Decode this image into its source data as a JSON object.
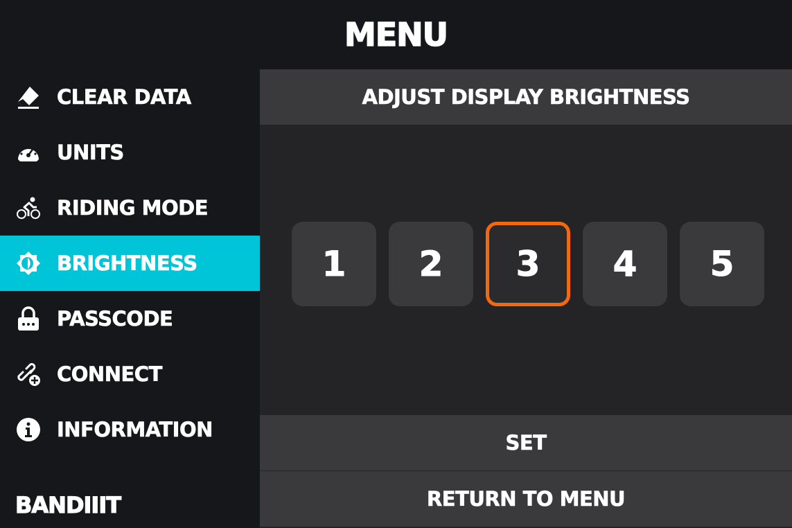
{
  "header": {
    "title": "MENU"
  },
  "sidebar": {
    "items": [
      {
        "label": "CLEAR DATA",
        "icon": "eraser-icon",
        "active": false
      },
      {
        "label": "UNITS",
        "icon": "speedometer-icon",
        "active": false
      },
      {
        "label": "RIDING MODE",
        "icon": "cyclist-icon",
        "active": false
      },
      {
        "label": "BRIGHTNESS",
        "icon": "brightness-icon",
        "active": true
      },
      {
        "label": "PASSCODE",
        "icon": "lock-icon",
        "active": false
      },
      {
        "label": "CONNECT",
        "icon": "link-add-icon",
        "active": false
      },
      {
        "label": "INFORMATION",
        "icon": "info-icon",
        "active": false
      }
    ],
    "brand": "BANDIIIT",
    "active_color": "#00c5d8"
  },
  "panel": {
    "header": "ADJUST DISPLAY BRIGHTNESS",
    "levels": [
      "1",
      "2",
      "3",
      "4",
      "5"
    ],
    "selected_level": "3",
    "selected_color": "#f26a0f",
    "set_label": "SET",
    "return_label": "RETURN TO MENU"
  }
}
